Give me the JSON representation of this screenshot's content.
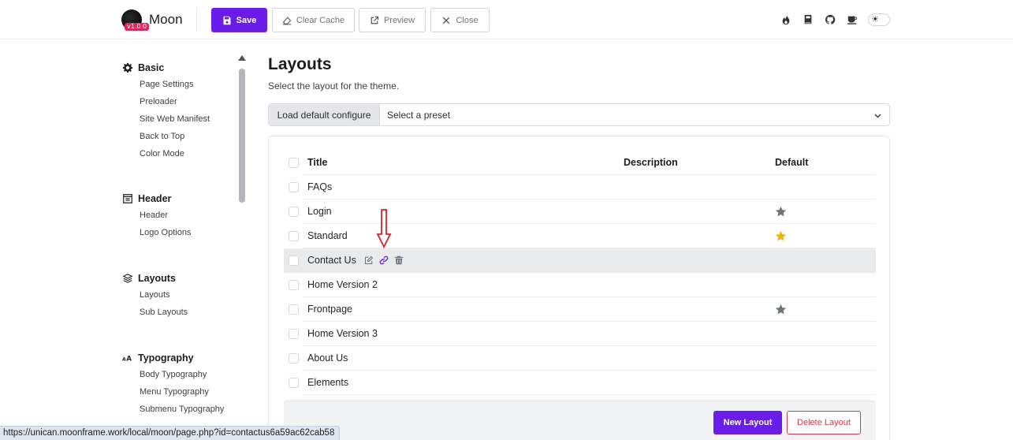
{
  "app": {
    "name": "Moon",
    "version": "v1.0.0"
  },
  "toolbar": {
    "save_label": "Save",
    "clear_cache_label": "Clear Cache",
    "preview_label": "Preview",
    "close_label": "Close"
  },
  "top_icons": [
    "fire-icon",
    "book-icon",
    "github-icon",
    "coffee-icon",
    "theme-toggle"
  ],
  "sidebar": {
    "groups": [
      {
        "title": "Basic",
        "icon": "gear-icon",
        "items": [
          "Page Settings",
          "Preloader",
          "Site Web Manifest",
          "Back to Top",
          "Color Mode"
        ]
      },
      {
        "title": "Header",
        "icon": "header-icon",
        "items": [
          "Header",
          "Logo Options"
        ]
      },
      {
        "title": "Layouts",
        "icon": "layers-icon",
        "items": [
          "Layouts",
          "Sub Layouts"
        ]
      },
      {
        "title": "Typography",
        "icon": "typography-icon",
        "items": [
          "Body Typography",
          "Menu Typography",
          "Submenu Typography"
        ]
      }
    ]
  },
  "main": {
    "title": "Layouts",
    "subtitle": "Select the layout for the theme.",
    "preset": {
      "label": "Load default configure",
      "selected": "Select a preset"
    },
    "table": {
      "headers": {
        "title": "Title",
        "description": "Description",
        "default": "Default"
      },
      "rows": [
        {
          "title": "FAQs",
          "default": "none"
        },
        {
          "title": "Login",
          "default": "gray-star"
        },
        {
          "title": "Standard",
          "default": "gold-star"
        },
        {
          "title": "Contact Us",
          "default": "none",
          "hovered": true
        },
        {
          "title": "Home Version 2",
          "default": "none"
        },
        {
          "title": "Frontpage",
          "default": "gray-star"
        },
        {
          "title": "Home Version 3",
          "default": "none"
        },
        {
          "title": "About Us",
          "default": "none"
        },
        {
          "title": "Elements",
          "default": "none"
        }
      ]
    },
    "new_layout_label": "New Layout",
    "delete_layout_label": "Delete Layout"
  },
  "status_url": "https://unican.moonframe.work/local/moon/page.php?id=contactus6a59ac62cab58",
  "colors": {
    "accent": "#6a1de8",
    "danger": "#dc3545",
    "gold_star": "#f5b301",
    "gray_star": "#6c757d"
  }
}
